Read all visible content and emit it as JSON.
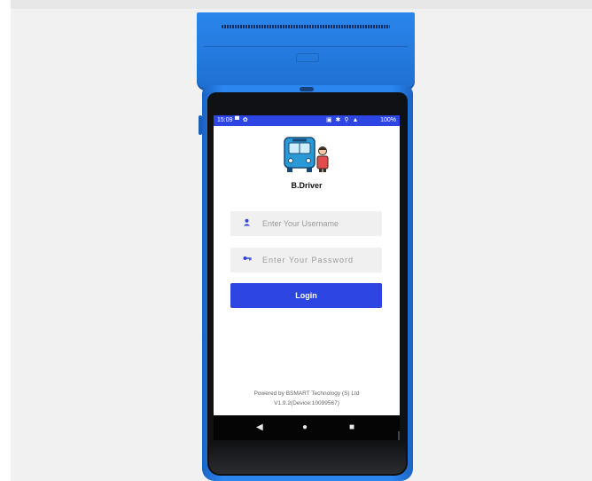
{
  "status_bar": {
    "time": "15:09",
    "left_icons": "▀ ✿",
    "right_icons": "▣ ✱ ⚲ ▲",
    "battery": "100%",
    "color": "#2c45e3"
  },
  "app": {
    "name": "B.Driver",
    "logo_icon": "bus-with-driver"
  },
  "form": {
    "username_placeholder": "Enter Your Username",
    "password_placeholder": "Enter Your Password",
    "login_label": "Login",
    "accent_color": "#2c45e3"
  },
  "footer": {
    "powered_by": "Powered by BSMART Technology (S) Ltd",
    "version": "V1.9.2(Device:10099567)"
  },
  "navigation": {
    "back": "◀",
    "home": "●",
    "recent": "■"
  },
  "device": {
    "body_color": "#2b87ef"
  }
}
